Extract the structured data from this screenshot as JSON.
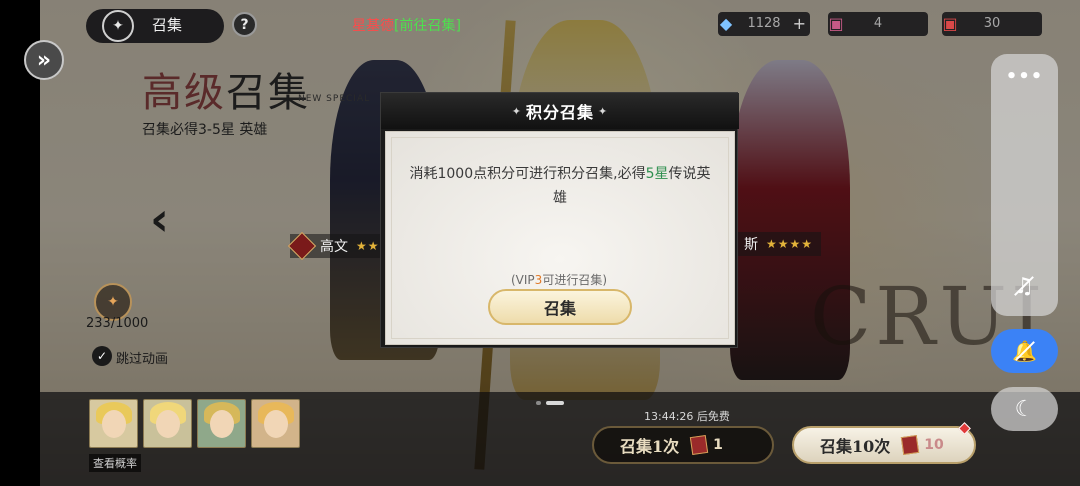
{
  "header": {
    "title": "召集",
    "title_ornament": "✦",
    "help_label": "?",
    "marquee_prefix": "星基德",
    "marquee_link": "[前往召集]"
  },
  "resources": [
    {
      "icon": "crystal-icon",
      "glyph": "◆",
      "value": "1128",
      "plus": "+"
    },
    {
      "icon": "scroll-ticket-icon",
      "glyph": "▣",
      "value": "4"
    },
    {
      "icon": "red-ticket-icon",
      "glyph": "▣",
      "value": "30"
    }
  ],
  "pool": {
    "title_prefix": "高级",
    "title_main": "召集",
    "title_en": "NEW SPECIAL",
    "subtitle": "召集必得3-5星 英雄",
    "prev_arrow": "‹",
    "collapse_glyph": "»"
  },
  "heroes": {
    "left_name": "高文",
    "left_stars": "★★",
    "right_name": "斯",
    "right_stars": "★★★★",
    "backdrop_text": "CRUI"
  },
  "progress": {
    "glyph": "✦",
    "text": "233/1000"
  },
  "skip": {
    "checked_glyph": "✓",
    "label": "跳过动画"
  },
  "bottom": {
    "rates_label": "查看概率",
    "free_timer": "13:44:26 后免费",
    "draw_one_label": "召集1次",
    "draw_one_cost": "1",
    "draw_ten_label": "召集10次",
    "draw_ten_cost": "10"
  },
  "modal": {
    "title": "积分召集",
    "title_ornament": "✦",
    "message_part1": "消耗1000点积分可进行积分召集,必得",
    "message_highlight": "5星",
    "message_part2": "传说英雄",
    "vip_prefix": "(VIP",
    "vip_level": "3",
    "vip_suffix": "可进行召集)",
    "confirm_label": "召集"
  },
  "float_toolbar": {
    "more_glyph": "•••",
    "music_glyph": "♫",
    "mute_glyph": "🔔",
    "dark_glyph": "☾"
  },
  "colors": {
    "modal_highlight": "#2f8f4f",
    "vip_highlight": "#e07a2a",
    "mute_active": "#3b82f6",
    "marquee_red": "#ff4a4a",
    "marquee_green": "#4ee04e"
  }
}
